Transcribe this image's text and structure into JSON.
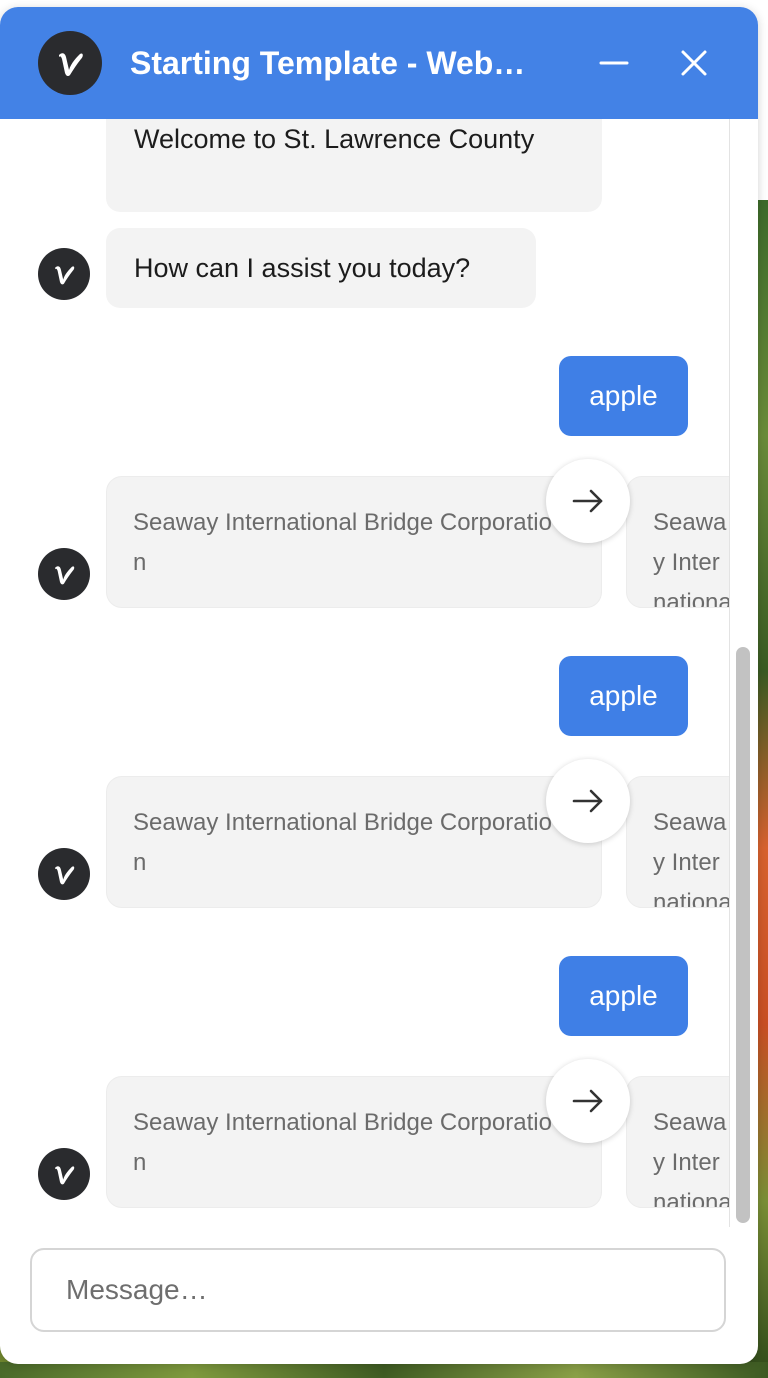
{
  "window": {
    "title": "Starting Template - Web…",
    "accent_color": "#4382e6",
    "icons": {
      "logo": "v-logo-icon",
      "minimize": "minimize-icon",
      "close": "close-icon"
    }
  },
  "messages": {
    "bot_welcome": "Welcome to St. Lawrence County",
    "bot_assist": "How can I assist you today?",
    "exchanges": [
      {
        "user": "apple",
        "cards": [
          "Seaway International Bridge Corporation",
          "Seaway International Bridge Corporation"
        ]
      },
      {
        "user": "apple",
        "cards": [
          "Seaway International Bridge Corporation",
          "Seaway International Bridge Corporation"
        ]
      },
      {
        "user": "apple",
        "cards": [
          "Seaway International Bridge Corporation",
          "Seaway International Bridge Corporation"
        ]
      }
    ],
    "next_arrow_icon": "arrow-right-icon"
  },
  "composer": {
    "placeholder": "Message…",
    "value": ""
  }
}
